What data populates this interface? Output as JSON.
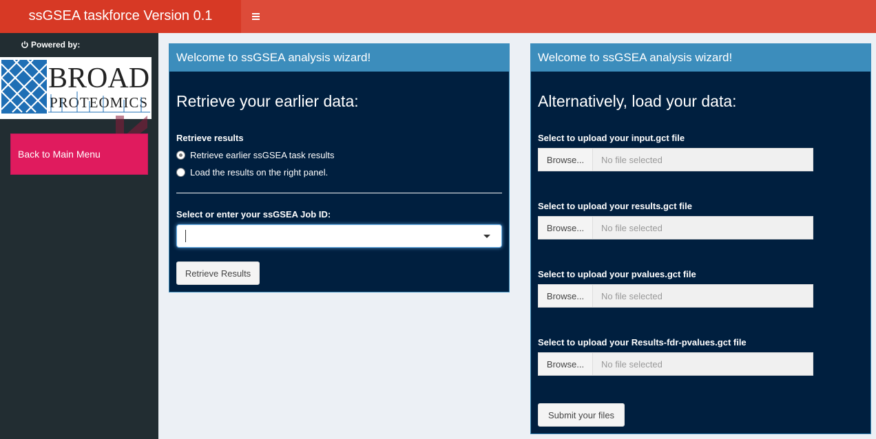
{
  "header": {
    "title": "ssGSEA taskforce Version 0.1",
    "colors": {
      "bar": "#dd4b39",
      "logo": "#d73925"
    }
  },
  "sidebar": {
    "powered_by": "Powered by:",
    "logo_text": {
      "line1": "BROAD",
      "line2": "PROTEOMICS"
    },
    "back_button": "Back to Main Menu"
  },
  "left_panel": {
    "header": "Welcome to ssGSEA analysis wizard!",
    "title": "Retrieve your earlier data:",
    "radio_label": "Retrieve results",
    "radio_options": [
      {
        "label": "Retrieve earlier ssGSEA task results",
        "selected": true
      },
      {
        "label": "Load the results on the right panel.",
        "selected": false
      }
    ],
    "job_label": "Select or enter your ssGSEA Job ID:",
    "job_value": "",
    "retrieve_button": "Retrieve Results"
  },
  "right_panel": {
    "header": "Welcome to ssGSEA analysis wizard!",
    "title": "Alternatively, load your data:",
    "uploads": [
      {
        "label": "Select to upload your input.gct file",
        "button": "Browse...",
        "placeholder": "No file selected"
      },
      {
        "label": "Select to upload your results.gct file",
        "button": "Browse...",
        "placeholder": "No file selected"
      },
      {
        "label": "Select to upload your pvalues.gct file",
        "button": "Browse...",
        "placeholder": "No file selected"
      },
      {
        "label": "Select to upload your Results-fdr-pvalues.gct file",
        "button": "Browse...",
        "placeholder": "No file selected"
      }
    ],
    "submit_button": "Submit your files"
  }
}
